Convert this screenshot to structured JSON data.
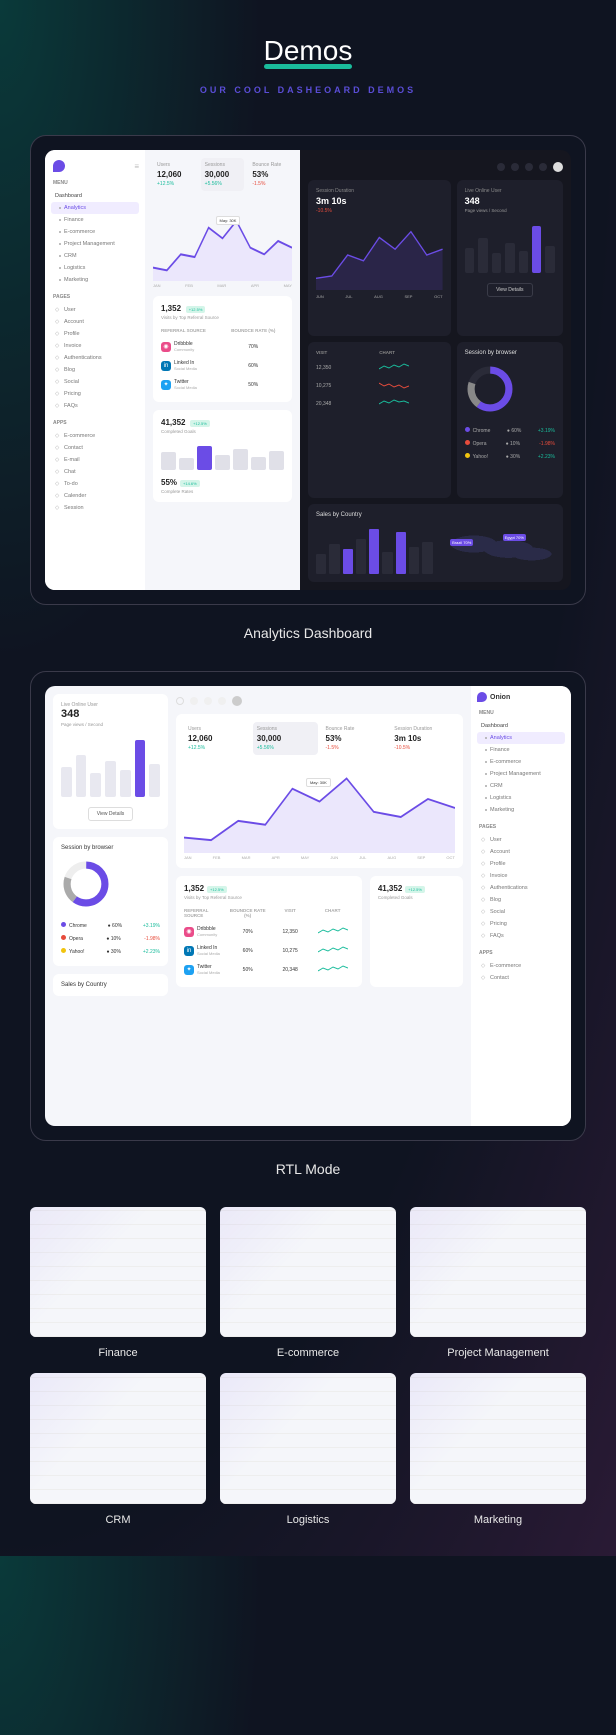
{
  "hero": {
    "title": "Demos",
    "subtitle": "OUR COOL DASHEOARD DEMOS"
  },
  "panel1": {
    "label": "Analytics Dashboard"
  },
  "panel2": {
    "label": "RTL Mode"
  },
  "brand": "Onion",
  "sidebar": {
    "menu_head": "MENU",
    "dashboard": "Dashboard",
    "items": [
      "Analytics",
      "Finance",
      "E-commerce",
      "Project Management",
      "CRM",
      "Logistics",
      "Marketing"
    ],
    "pages_head": "PAGES",
    "pages": [
      "User",
      "Account",
      "Profile",
      "Invoice",
      "Authentications",
      "Blog",
      "Social",
      "Pricing",
      "FAQs"
    ],
    "apps_head": "APPS",
    "apps": [
      "E-commerce",
      "Contact",
      "E-mail",
      "Chat",
      "To-do",
      "Calender",
      "Session"
    ]
  },
  "stats": {
    "users": {
      "label": "Users",
      "value": "12,060",
      "change": "+12.5%"
    },
    "sessions": {
      "label": "Sessions",
      "value": "30,000",
      "change": "+5.56%"
    },
    "bounce": {
      "label": "Bounce Rate",
      "value": "53%",
      "change": "-1.5%"
    },
    "duration": {
      "label": "Session Duration",
      "value": "3m 10s",
      "change": "-10.5%"
    }
  },
  "chart_tag": "May: 30K",
  "months": [
    "JAN",
    "FEB",
    "MAR",
    "APR",
    "MAY",
    "JUN",
    "JUL",
    "AUG",
    "SEP",
    "OCT"
  ],
  "live": {
    "label": "Live Online User",
    "value": "348",
    "sub": "Page views / Second",
    "btn": "View Details"
  },
  "visits": {
    "value": "1,352",
    "badge": "+12.5%",
    "sub": "Visits by Top Referral Source",
    "headers": {
      "src": "REFERRAL SOURCE",
      "bounce": "BOUNDCE RATE (%)",
      "visit": "VISIT",
      "chart": "CHART"
    },
    "rows": [
      {
        "name": "Dribbble",
        "sub": "Community",
        "bounce": "70%",
        "visit": "12,350"
      },
      {
        "name": "Linked In",
        "sub": "Social Media",
        "bounce": "60%",
        "visit": "10,275"
      },
      {
        "name": "Twitter",
        "sub": "Social Media",
        "bounce": "50%",
        "visit": "20,348"
      }
    ]
  },
  "goals": {
    "value": "41,352",
    "badge": "+12.5%",
    "sub": "Completed Goals"
  },
  "rates": {
    "value": "55%",
    "badge": "+14.6%",
    "sub": "Complete Rates"
  },
  "browser": {
    "title": "Session by browser",
    "rows": [
      {
        "name": "Chrome",
        "share": "60%",
        "chg": "+3.19%",
        "color": "#6b4ce6",
        "pos": true
      },
      {
        "name": "Opera",
        "share": "10%",
        "chg": "-1.98%",
        "color": "#e74c3c",
        "pos": false
      },
      {
        "name": "Yahoo!",
        "share": "30%",
        "chg": "+2.23%",
        "color": "#f1c40f",
        "pos": true
      }
    ]
  },
  "sales": {
    "title": "Sales by Country",
    "pins": [
      "Brazil 70%",
      "Egypt 70%"
    ]
  },
  "chart_data": {
    "type": "area",
    "x": [
      "JAN",
      "FEB",
      "MAR",
      "APR",
      "MAY",
      "JUN",
      "JUL",
      "AUG",
      "SEP",
      "OCT"
    ],
    "series": [
      {
        "name": "Sessions",
        "values": [
          8,
          6,
          12,
          10,
          30,
          22,
          28,
          18,
          15,
          20
        ]
      }
    ],
    "ylabel": "K",
    "annotation": "May: 30K"
  },
  "thumbs": [
    "Finance",
    "E-commerce",
    "Project Management",
    "CRM",
    "Logistics",
    "Marketing"
  ]
}
